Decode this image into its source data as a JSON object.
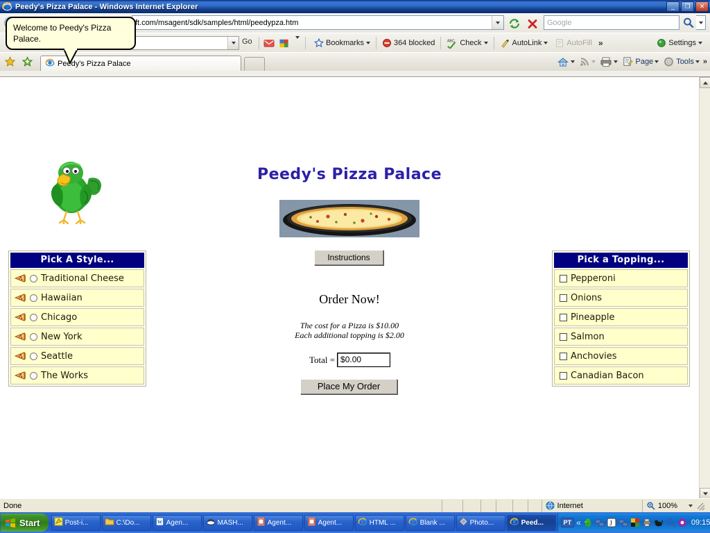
{
  "window": {
    "title": "Peedy's Pizza Palace - Windows Internet Explorer",
    "minimize_label": "_",
    "restore_label": "❐",
    "close_label": "✕"
  },
  "address_bar": {
    "url": "ft.com/msagent/sdk/samples/html/peedypza.htm",
    "refresh_icon": "refresh-icon",
    "stop_icon": "stop-icon",
    "search_placeholder": "Google"
  },
  "google_toolbar": {
    "search_value": "",
    "go_label": "Go",
    "items": [
      {
        "label": "Bookmarks",
        "icon": "star-icon",
        "has_caret": true,
        "dim": false
      },
      {
        "label": "364 blocked",
        "icon": "blocked-icon",
        "has_caret": false,
        "dim": false
      },
      {
        "label": "Check",
        "icon": "spellcheck-icon",
        "has_caret": true,
        "dim": false
      },
      {
        "label": "AutoLink",
        "icon": "autolink-icon",
        "has_caret": true,
        "dim": false
      },
      {
        "label": "AutoFill",
        "icon": "autofill-icon",
        "has_caret": false,
        "dim": true
      }
    ],
    "overflow_label": "»",
    "settings_label": "Settings"
  },
  "tabs": {
    "favorites_icon": "star-favorites-icon",
    "add_favorite_icon": "add-favorite-icon",
    "active_tab_label": "Peedy's Pizza Palace"
  },
  "command_bar": {
    "home_label": "",
    "feeds_label": "",
    "print_label": "",
    "page_label": "Page",
    "tools_label": "Tools",
    "overflow_label": "»"
  },
  "balloon": {
    "text": "Welcome to Peedy's Pizza Palace."
  },
  "page": {
    "title": "Peedy's Pizza Palace",
    "agent_name": "peedy-parrot",
    "pizza_image_alt": "pizza-photo",
    "instructions_button": "Instructions",
    "order_heading": "Order Now!",
    "cost_line_1": "The cost for a Pizza is $10.00",
    "cost_line_2": "Each additional topping is $2.00",
    "total_label": "Total =",
    "total_value": "$0.00",
    "place_order_button": "Place My Order",
    "styles": {
      "header": "Pick A Style...",
      "items": [
        {
          "label": "Traditional Cheese",
          "selected": false
        },
        {
          "label": "Hawaiian",
          "selected": false
        },
        {
          "label": "Chicago",
          "selected": false
        },
        {
          "label": "New York",
          "selected": false
        },
        {
          "label": "Seattle",
          "selected": false
        },
        {
          "label": "The Works",
          "selected": false
        }
      ]
    },
    "toppings": {
      "header": "Pick a Topping...",
      "items": [
        {
          "label": "Pepperoni",
          "checked": false
        },
        {
          "label": "Onions",
          "checked": false
        },
        {
          "label": "Pineapple",
          "checked": false
        },
        {
          "label": "Salmon",
          "checked": false
        },
        {
          "label": "Anchovies",
          "checked": false
        },
        {
          "label": "Canadian Bacon",
          "checked": false
        }
      ]
    }
  },
  "status_bar": {
    "message": "Done",
    "zone": "Internet",
    "zoom": "100%"
  },
  "taskbar": {
    "start_label": "Start",
    "items": [
      {
        "label": "Post-i...",
        "icon": "note-icon",
        "active": false
      },
      {
        "label": "C:\\Do...",
        "icon": "folder-icon",
        "active": false
      },
      {
        "label": "Agen...",
        "icon": "word-icon",
        "active": false
      },
      {
        "label": "MASH...",
        "icon": "mash-icon",
        "active": false
      },
      {
        "label": "Agent...",
        "icon": "powerpoint-icon",
        "active": false
      },
      {
        "label": "Agent...",
        "icon": "powerpoint-icon",
        "active": false
      },
      {
        "label": "HTML ...",
        "icon": "ie-icon",
        "active": false
      },
      {
        "label": "Blank ...",
        "icon": "ie-icon",
        "active": false
      },
      {
        "label": "Photo...",
        "icon": "photo-icon",
        "active": false
      },
      {
        "label": "Peed...",
        "icon": "ie-icon",
        "active": true
      }
    ],
    "tray": {
      "language": "PT",
      "expand_label": "«",
      "clock": "09:15"
    }
  },
  "colors": {
    "panel_header_bg": "#000080",
    "panel_row_bg": "#ffffcc",
    "page_title": "#2c20a8",
    "titlebar": "#1e4fa8",
    "taskbar": "#245fcb",
    "start_green": "#3f9227"
  }
}
